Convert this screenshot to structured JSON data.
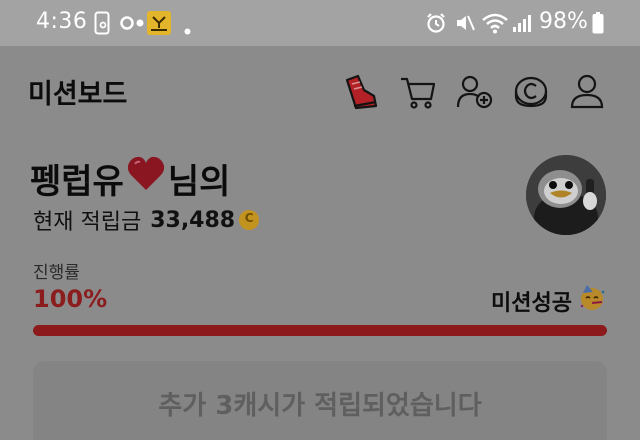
{
  "status_bar": {
    "time": "4:36",
    "battery": "98%",
    "icons": [
      "phone-key-icon",
      "toggle-icon",
      "app-badge-icon",
      "dot-icon",
      "alarm-icon",
      "mute-icon",
      "wifi-icon",
      "signal-icon",
      "battery-icon"
    ]
  },
  "header": {
    "title": "미션보드",
    "icons": [
      "shoe-icon",
      "cart-icon",
      "add-user-icon",
      "coin-icon",
      "profile-icon"
    ],
    "accent": "#c21f24"
  },
  "profile": {
    "name": "펭럽유",
    "name_suffix": "님의",
    "heart": "♥",
    "balance_label": "현재 적립금",
    "balance_amount": "33,488",
    "avatar": "penguin-avatar"
  },
  "progress": {
    "label": "진행률",
    "value": "100%",
    "fraction": 1.0,
    "status": "미션성공",
    "status_emoji": "party-face",
    "bar_color": "#8c1a1c"
  },
  "reward_button": {
    "label": "추가 3캐시가 적립되었습니다"
  }
}
